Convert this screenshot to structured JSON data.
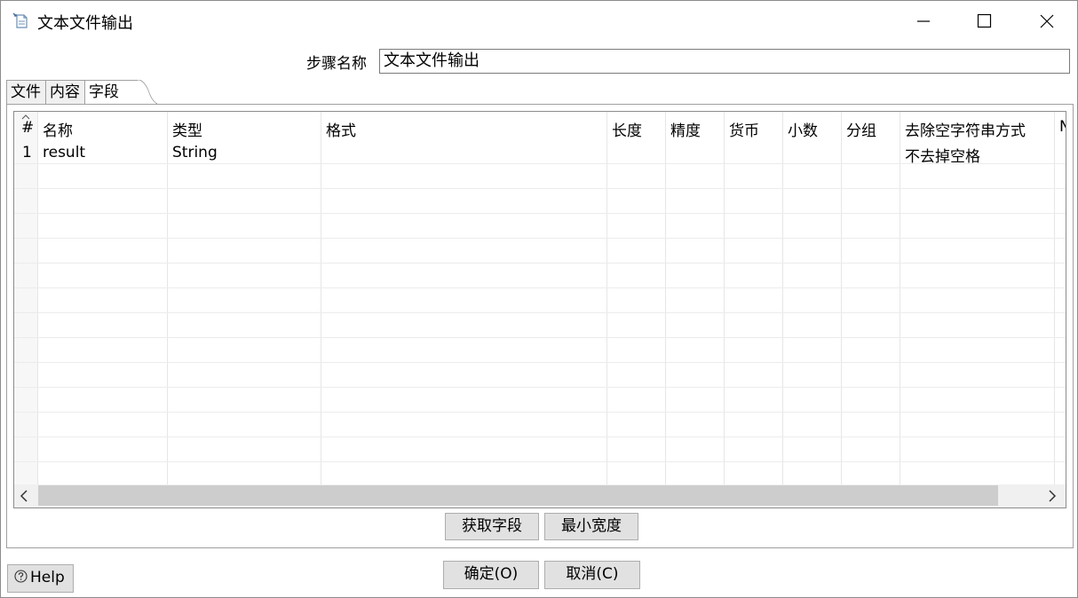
{
  "window": {
    "title": "文本文件输出",
    "icon": "document-output-icon"
  },
  "step": {
    "label": "步骤名称",
    "value": "文本文件输出"
  },
  "tabs": [
    {
      "label": "文件",
      "active": false
    },
    {
      "label": "内容",
      "active": false
    },
    {
      "label": "字段",
      "active": true
    }
  ],
  "table": {
    "columns": [
      "#",
      "名称",
      "类型",
      "格式",
      "长度",
      "精度",
      "货币",
      "小数",
      "分组",
      "去除空字符串方式",
      "N"
    ],
    "rows": [
      {
        "num": "1",
        "name": "result",
        "type": "String",
        "format": "",
        "length": "",
        "precision": "",
        "currency": "",
        "decimal": "",
        "group": "",
        "trim": "不去掉空格"
      }
    ]
  },
  "buttons": {
    "get_fields": "获取字段",
    "min_width": "最小宽度",
    "ok": "确定(O)",
    "cancel": "取消(C)",
    "help": "Help"
  },
  "colors": {
    "button_bg": "#e1e1e1",
    "scroll_thumb": "#cdcdcd",
    "border": "#a0a0a0"
  }
}
